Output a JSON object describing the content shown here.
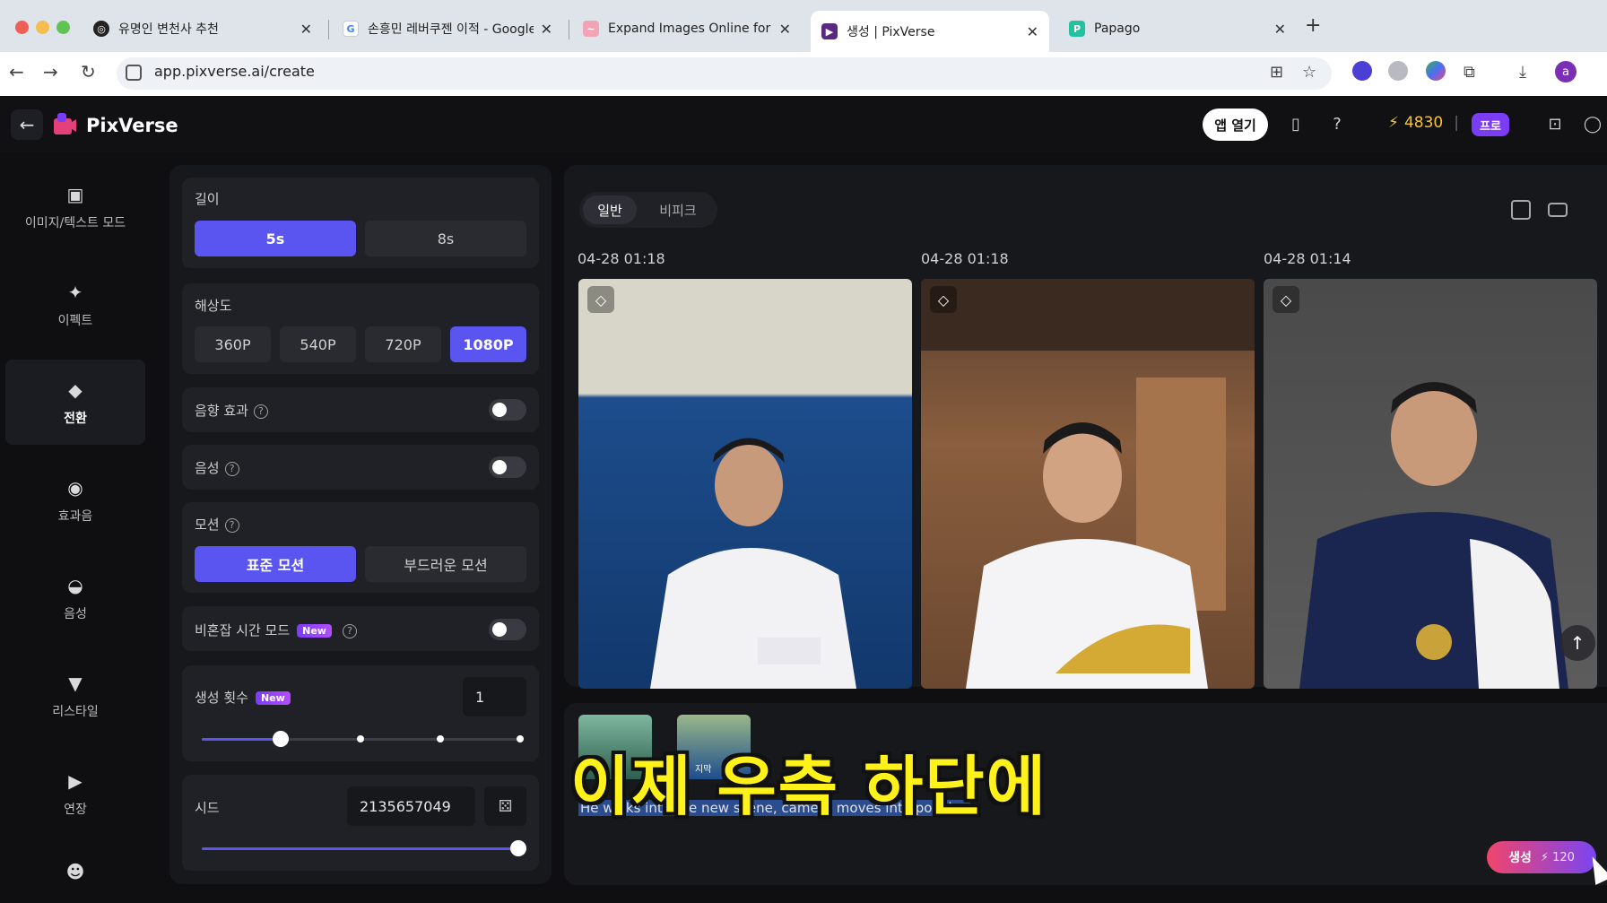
{
  "browser": {
    "tabs": [
      {
        "title": "유명인 변천사 추천",
        "favicon": "openai-icon",
        "color": "#222222"
      },
      {
        "title": "손흥민 레버쿠젠 이적 - Google Se",
        "favicon": "google-icon",
        "color": "#4285f4"
      },
      {
        "title": "Expand Images Online for Fre",
        "favicon": "expand-icon",
        "color": "#e84a6a"
      },
      {
        "title": "생성 | PixVerse",
        "favicon": "pixverse-icon",
        "color": "#5a2a82",
        "active": true
      },
      {
        "title": "Papago",
        "favicon": "papago-icon",
        "color": "#24c1a0"
      }
    ],
    "url": "app.pixverse.ai/create",
    "profile_initial": "a"
  },
  "header": {
    "logo": "PixVerse",
    "open_app": "앱 열기",
    "credits": "4830",
    "plan": "프로"
  },
  "sidebar": {
    "items": [
      {
        "label": "이미지/텍스트 모드",
        "icon": "image-icon"
      },
      {
        "label": "이펙트",
        "icon": "sparkle-icon"
      },
      {
        "label": "전환",
        "icon": "transition-icon",
        "active": true
      },
      {
        "label": "효과음",
        "icon": "sound-wave-icon"
      },
      {
        "label": "음성",
        "icon": "lips-icon"
      },
      {
        "label": "리스타일",
        "icon": "brush-icon"
      },
      {
        "label": "연장",
        "icon": "extend-icon"
      }
    ]
  },
  "settings": {
    "duration": {
      "label": "길이",
      "options": [
        "5s",
        "8s"
      ],
      "selected": "5s"
    },
    "resolution": {
      "label": "해상도",
      "options": [
        "360P",
        "540P",
        "720P",
        "1080P"
      ],
      "selected": "1080P"
    },
    "sound_effect": {
      "label": "음향 효과",
      "enabled": false
    },
    "voice": {
      "label": "음성",
      "enabled": false
    },
    "motion": {
      "label": "모션",
      "options": [
        "표준 모션",
        "부드러운 모션"
      ],
      "selected": "표준 모션"
    },
    "offpeak": {
      "label": "비혼잡 시간 모드",
      "badge": "New",
      "enabled": false
    },
    "count": {
      "label": "생성 횟수",
      "badge": "New",
      "value": "1",
      "slider_value": 1,
      "slider_max": 4
    },
    "seed": {
      "label": "시드",
      "value": "2135657049",
      "slider_fraction": 1.0
    }
  },
  "gallery": {
    "tabs": [
      "일반",
      "비피크"
    ],
    "selected_tab": "일반",
    "items": [
      {
        "timestamp": "04-28 01:18"
      },
      {
        "timestamp": "04-28 01:18"
      },
      {
        "timestamp": "04-28 01:14"
      }
    ]
  },
  "prompt": {
    "text": "He walks into the new scene, camera moves into position",
    "thumb_label": "지막"
  },
  "overlay_caption": "이제 우측 하단에",
  "generate": {
    "label": "생성",
    "cost": "120"
  }
}
